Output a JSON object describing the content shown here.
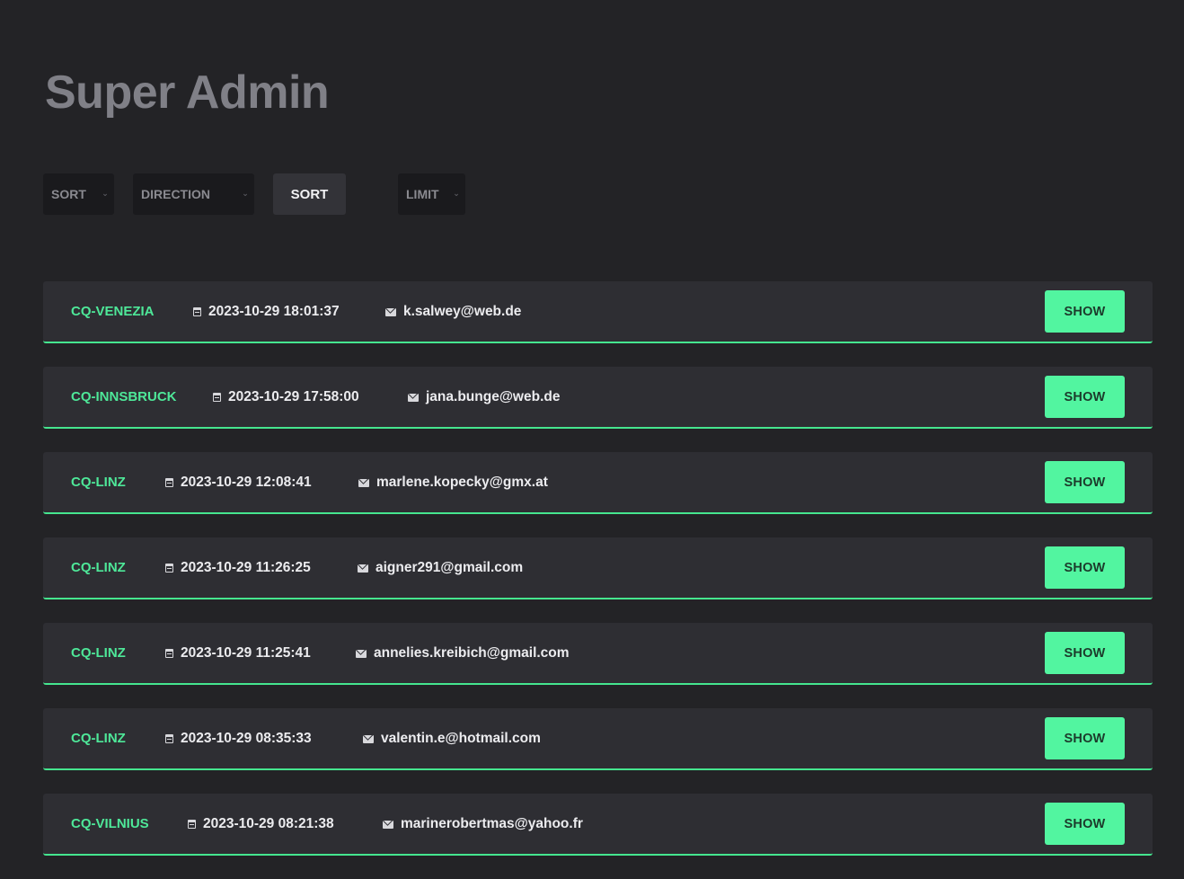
{
  "header": {
    "title": "Super Admin"
  },
  "controls": {
    "sort_select": "SORT",
    "direction_select": "DIRECTION",
    "sort_button": "SORT",
    "limit_select": "LIMIT",
    "chevron_icon": "chevron-down-icon"
  },
  "colors": {
    "background": "#232326",
    "row_background": "#2e2e33",
    "accent": "#52f5a0",
    "title": "#808087"
  },
  "entries": [
    {
      "place": "CQ-VENEZIA",
      "timestamp": "2023-10-29 18:01:37",
      "email": "k.salwey@web.de",
      "action": "SHOW"
    },
    {
      "place": "CQ-INNSBRUCK",
      "timestamp": "2023-10-29 17:58:00",
      "email": "jana.bunge@web.de",
      "action": "SHOW"
    },
    {
      "place": "CQ-LINZ",
      "timestamp": "2023-10-29 12:08:41",
      "email": "marlene.kopecky@gmx.at",
      "action": "SHOW"
    },
    {
      "place": "CQ-LINZ",
      "timestamp": "2023-10-29 11:26:25",
      "email": "aigner291@gmail.com",
      "action": "SHOW"
    },
    {
      "place": "CQ-LINZ",
      "timestamp": "2023-10-29 11:25:41",
      "email": "annelies.kreibich@gmail.com",
      "action": "SHOW"
    },
    {
      "place": "CQ-LINZ",
      "timestamp": "2023-10-29 08:35:33",
      "email": "valentin.e@hotmail.com",
      "action": "SHOW"
    },
    {
      "place": "CQ-VILNIUS",
      "timestamp": "2023-10-29 08:21:38",
      "email": "marinerobertmas@yahoo.fr",
      "action": "SHOW"
    }
  ]
}
